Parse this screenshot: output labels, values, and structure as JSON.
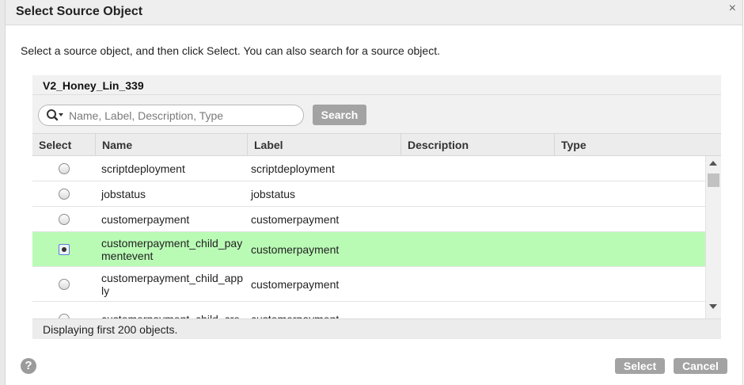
{
  "dialog": {
    "title": "Select Source Object",
    "close_icon": "close-icon",
    "instructions": "Select a source object, and then click Select. You can also search for a source object."
  },
  "connection": {
    "name": "V2_Honey_Lin_339"
  },
  "search": {
    "placeholder": "Name, Label, Description, Type",
    "value": "",
    "button_label": "Search"
  },
  "table": {
    "columns": [
      "Select",
      "Name",
      "Label",
      "Description",
      "Type"
    ],
    "rows": [
      {
        "name": "scriptdeployment",
        "label": "scriptdeployment",
        "description": "",
        "type": "",
        "selected": false
      },
      {
        "name": "jobstatus",
        "label": "jobstatus",
        "description": "",
        "type": "",
        "selected": false
      },
      {
        "name": "customerpayment",
        "label": "customerpayment",
        "description": "",
        "type": "",
        "selected": false
      },
      {
        "name": "customerpayment_child_paymentevent",
        "label": "customerpayment",
        "description": "",
        "type": "",
        "selected": true
      },
      {
        "name": "customerpayment_child_apply",
        "label": "customerpayment",
        "description": "",
        "type": "",
        "selected": false
      },
      {
        "name": "customerpayment_child_cre",
        "label": "customerpayment",
        "description": "",
        "type": "",
        "selected": false
      }
    ]
  },
  "status": {
    "text": "Displaying first 200 objects."
  },
  "footer": {
    "help_icon": "question-mark-icon",
    "select_label": "Select",
    "cancel_label": "Cancel"
  },
  "colors": {
    "selected_row": "#b9fbb5",
    "button_gray": "#a3a3a3",
    "header_bg": "#eeeeee"
  }
}
